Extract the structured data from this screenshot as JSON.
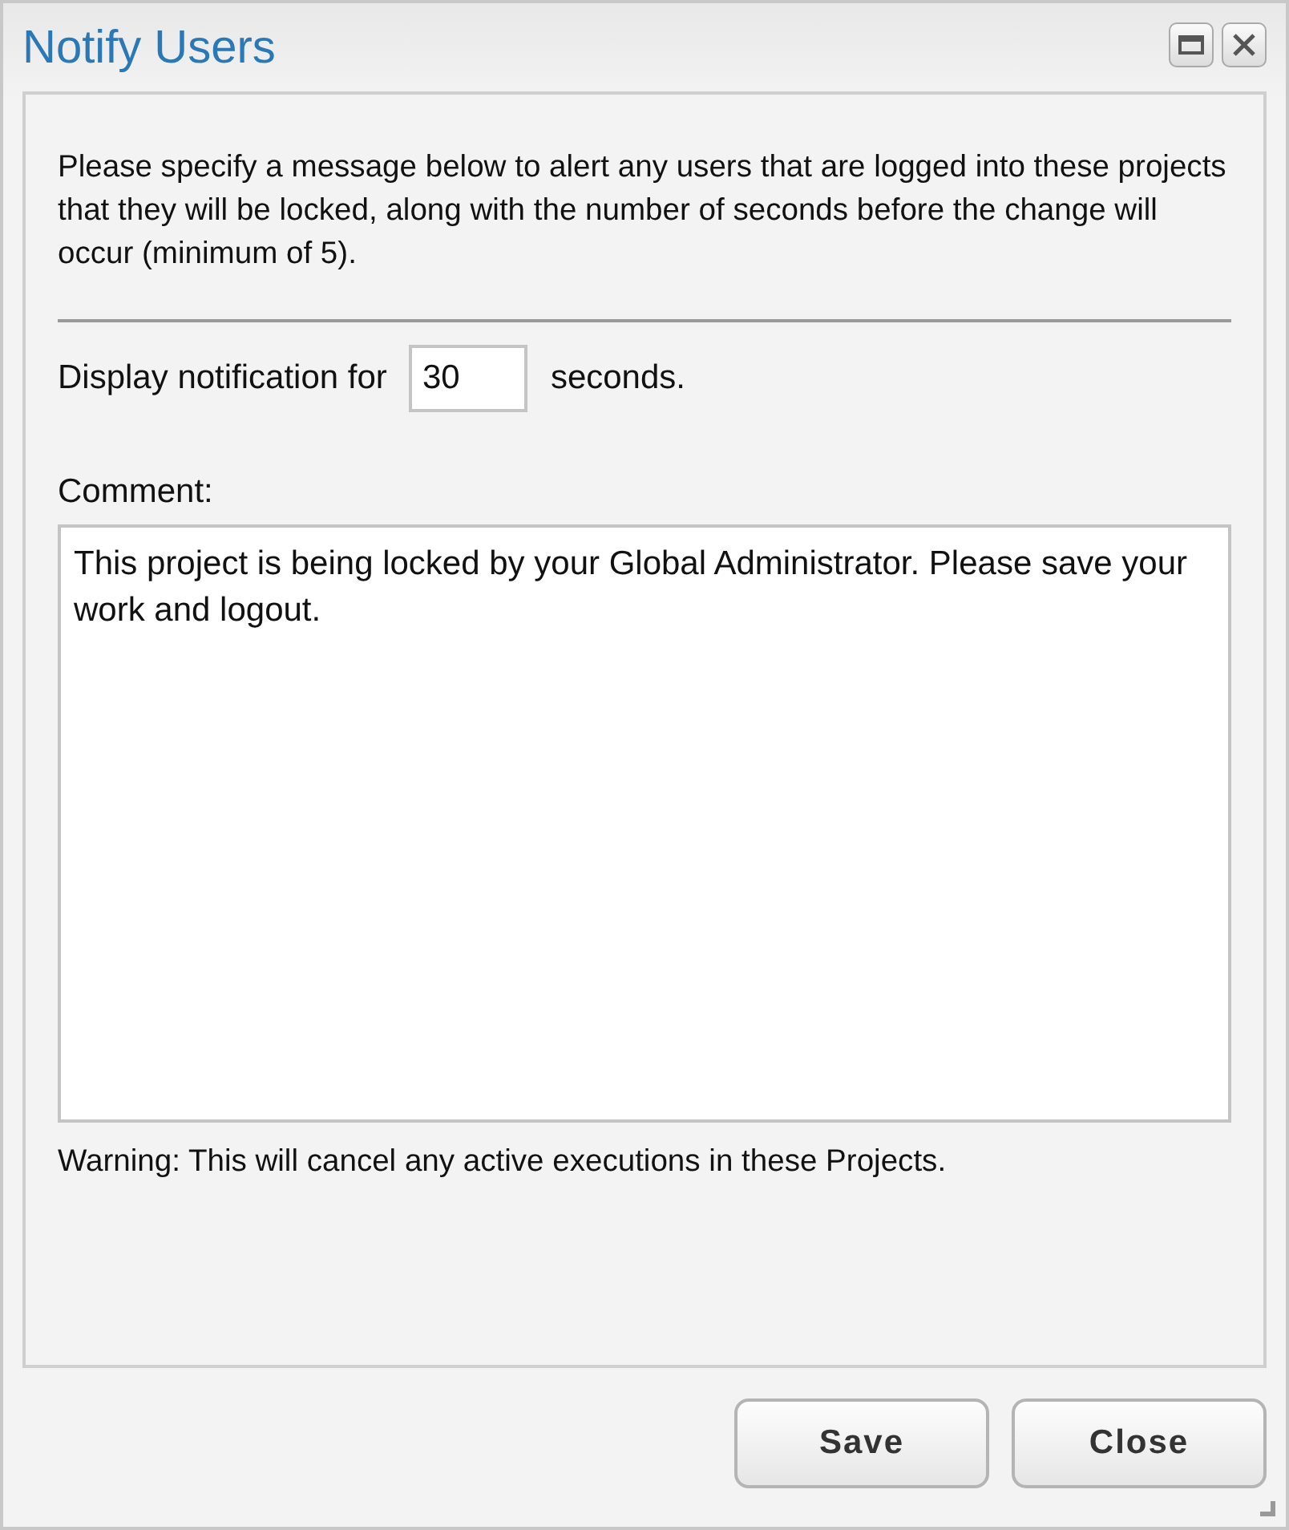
{
  "window": {
    "title": "Notify Users"
  },
  "intro": "Please specify a message below to alert any users that are logged into these projects that they will be locked, along with the number of seconds before the change will occur (minimum of 5).",
  "duration": {
    "label": "Display notification for",
    "value": "30",
    "unit": "seconds."
  },
  "comment": {
    "label": "Comment:",
    "value": "This project is being locked by your Global Administrator. Please save your work and logout."
  },
  "warning": "Warning: This will cancel any active executions in these Projects.",
  "buttons": [
    "Save",
    "Close"
  ]
}
